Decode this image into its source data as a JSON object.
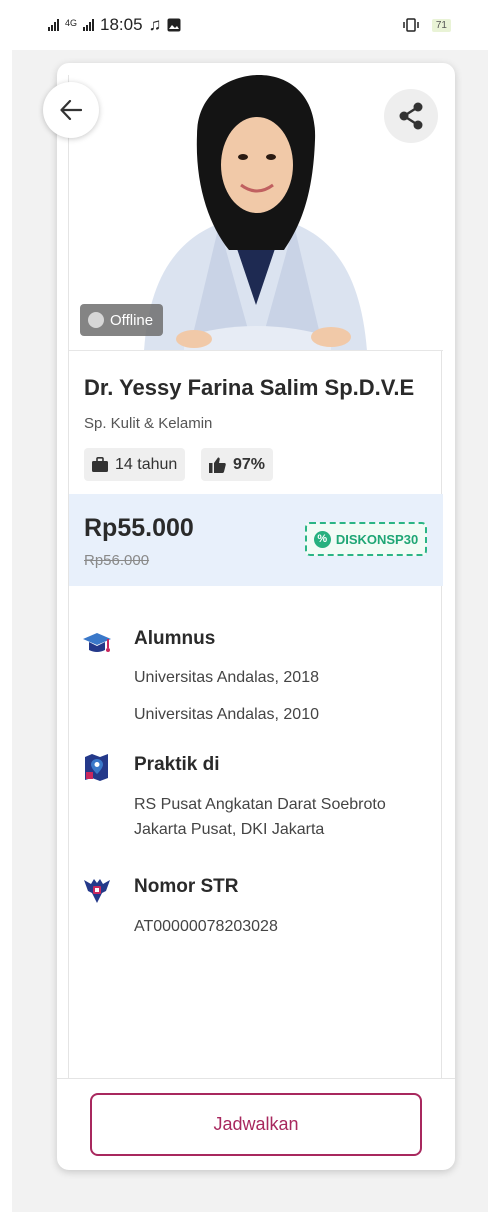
{
  "status_bar": {
    "network": "4G",
    "time": "18:05",
    "battery": "71"
  },
  "header": {
    "back_icon": "arrow-left-icon",
    "share_icon": "share-icon"
  },
  "doctor": {
    "status_badge": "Offline",
    "name": "Dr. Yessy Farina Salim Sp.D.V.E",
    "specialty": "Sp. Kulit & Kelamin",
    "experience": "14 tahun",
    "rating": "97%"
  },
  "pricing": {
    "price": "Rp55.000",
    "original_price": "Rp56.000",
    "promo_code": "DISKONSP30"
  },
  "alumnus": {
    "title": "Alumnus",
    "items": [
      "Universitas Andalas, 2018",
      "Universitas Andalas, 2010"
    ]
  },
  "practice": {
    "title": "Praktik di",
    "line1": "RS Pusat Angkatan Darat Soebroto",
    "line2": "Jakarta Pusat, DKI Jakarta"
  },
  "str": {
    "title": "Nomor STR",
    "number": "AT00000078203028"
  },
  "actions": {
    "schedule_label": "Jadwalkan"
  },
  "colors": {
    "brand": "#a8285e",
    "promo": "#1fa675",
    "price_bg": "#e8f0fb"
  }
}
